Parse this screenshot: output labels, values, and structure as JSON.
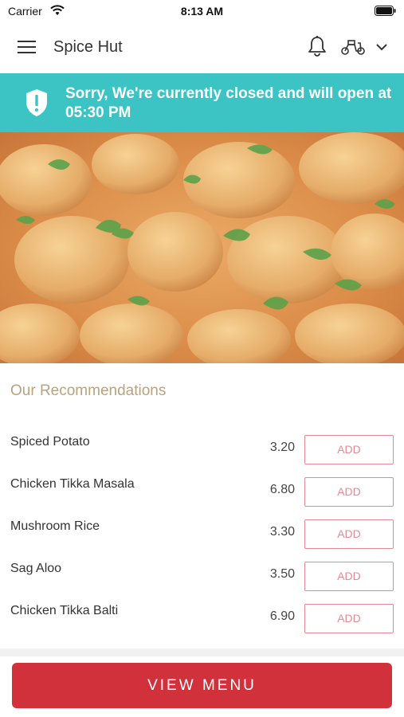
{
  "status_bar": {
    "carrier": "Carrier",
    "time": "8:13 AM"
  },
  "header": {
    "title": "Spice Hut",
    "menu_icon": "hamburger-menu-icon",
    "notification_icon": "bell-icon",
    "delivery_icon": "scooter-icon",
    "dropdown_icon": "chevron-down-icon"
  },
  "banner": {
    "message": "Sorry, We're currently closed and will open at 05:30 PM",
    "icon": "shield-icon",
    "color": "#3cc4c4"
  },
  "hero": {
    "subject": "curry"
  },
  "recommendations": {
    "title": "Our Recommendations",
    "add_label": "ADD",
    "items": [
      {
        "name": "Spiced Potato",
        "price": "3.20"
      },
      {
        "name": "Chicken Tikka Masala",
        "price": "6.80"
      },
      {
        "name": "Mushroom Rice",
        "price": "3.30"
      },
      {
        "name": "Sag Aloo",
        "price": "3.50"
      },
      {
        "name": "Chicken Tikka Balti",
        "price": "6.90"
      }
    ]
  },
  "footer": {
    "view_menu_label": "VIEW MENU",
    "accent": "#d1313b"
  }
}
